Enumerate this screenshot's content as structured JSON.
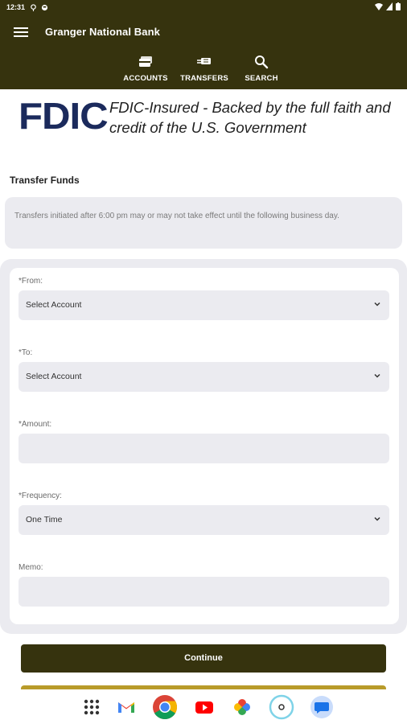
{
  "status_bar": {
    "time": "12:31"
  },
  "header": {
    "title": "Granger National Bank",
    "tabs": [
      {
        "label": "ACCOUNTS",
        "icon": "accounts-card-icon"
      },
      {
        "label": "TRANSFERS",
        "icon": "transfers-icon"
      },
      {
        "label": "SEARCH",
        "icon": "search-icon"
      }
    ]
  },
  "fdic": {
    "logo": "FDIC",
    "text": "FDIC-Insured - Backed by the full faith and credit of the U.S. Government"
  },
  "page": {
    "title": "Transfer Funds",
    "notice": "Transfers initiated after 6:00 pm may or may not take effect until the following business day."
  },
  "form": {
    "from_label": "*From:",
    "from_value": "Select Account",
    "to_label": "*To:",
    "to_value": "Select Account",
    "amount_label": "*Amount:",
    "amount_value": "",
    "frequency_label": "*Frequency:",
    "frequency_value": "One Time",
    "memo_label": "Memo:",
    "memo_value": ""
  },
  "buttons": {
    "continue": "Continue"
  },
  "colors": {
    "brand": "#36330e",
    "accent_gold": "#b89b2a",
    "field_bg": "#ebebf0",
    "fdic_blue": "#1b2a5c"
  },
  "dock": [
    "apps-icon",
    "gmail-icon",
    "chrome-icon",
    "youtube-icon",
    "photos-icon",
    "assistant-icon",
    "messages-icon"
  ]
}
